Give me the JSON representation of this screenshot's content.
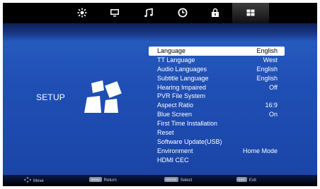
{
  "topbar": {
    "tabs": [
      {
        "icon": "picture-icon"
      },
      {
        "icon": "tv-channel-icon"
      },
      {
        "icon": "music-note-icon"
      },
      {
        "icon": "clock-icon"
      },
      {
        "icon": "lock-icon"
      },
      {
        "icon": "setup-grid-icon"
      }
    ]
  },
  "page": {
    "title": "SETUP"
  },
  "menu": {
    "items": [
      {
        "label": "Language",
        "value": "English"
      },
      {
        "label": "TT Language",
        "value": "West"
      },
      {
        "label": "Audio Languages",
        "value": "English"
      },
      {
        "label": "Subtitle Language",
        "value": "English"
      },
      {
        "label": "Hearing Impaired",
        "value": "Off"
      },
      {
        "label": "PVR File System",
        "value": ""
      },
      {
        "label": "Aspect Ratio",
        "value": "16:9"
      },
      {
        "label": "Blue Screen",
        "value": "On"
      },
      {
        "label": "First Time Installation",
        "value": ""
      },
      {
        "label": "Reset",
        "value": ""
      },
      {
        "label": "Software Update(USB)",
        "value": ""
      },
      {
        "label": "Environment",
        "value": "Home Mode"
      },
      {
        "label": "HDMI CEC",
        "value": ""
      }
    ]
  },
  "footer": {
    "move": {
      "text": "Move"
    },
    "return": {
      "key": "MENU",
      "text": "Return"
    },
    "select": {
      "key": "ENTER",
      "text": "Select"
    },
    "exit": {
      "key": "EXIT",
      "text": "Exit"
    }
  },
  "colors": {
    "background": "#1f4fb4",
    "selected_row": "#ffffff",
    "topbar": "#000000"
  }
}
